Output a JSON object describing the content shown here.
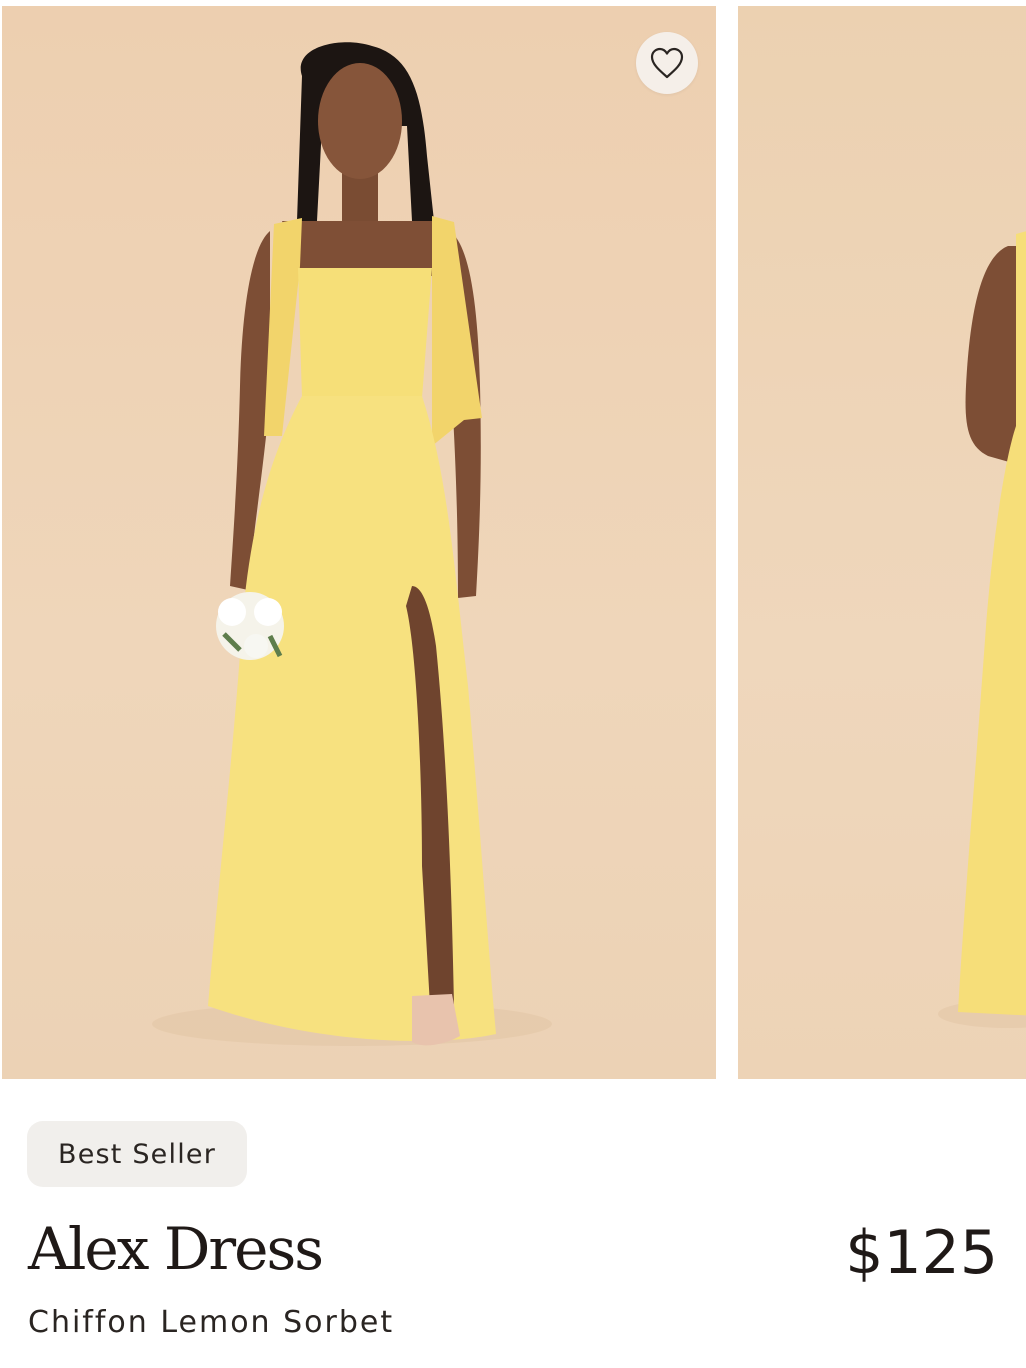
{
  "carousel": {
    "images": [
      {
        "subject": "model in yellow dress front view"
      },
      {
        "subject": "model in yellow dress side view"
      }
    ],
    "favorite_icon": "heart-outline-icon"
  },
  "product": {
    "badge": "Best Seller",
    "name": "Alex Dress",
    "price": "$125",
    "variant": "Chiffon Lemon Sorbet"
  },
  "colors": {
    "backdrop": "#EDD2B4",
    "dress": "#F5E07E",
    "text": "#1F1917",
    "badge_bg": "#F1EFEC"
  }
}
